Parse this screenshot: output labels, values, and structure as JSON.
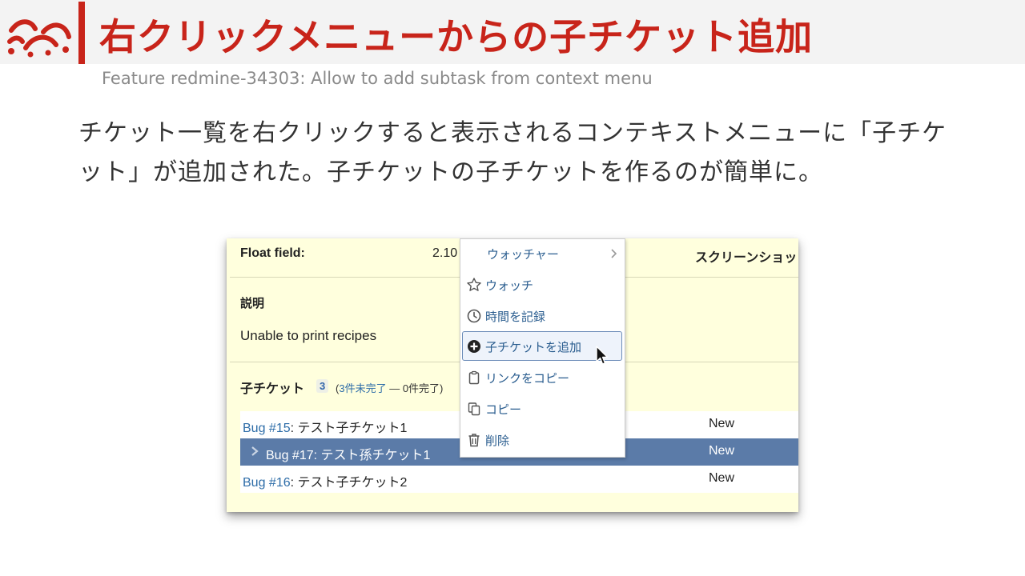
{
  "header": {
    "title": "右クリックメニューからの子チケット追加",
    "subtitle": "Feature redmine-34303: Allow to add subtask from context menu"
  },
  "body": {
    "text": "チケット一覧を右クリックすると表示されるコンテキストメニューに「子チケット」が追加された。子チケットの子チケットを作るのが簡単に。"
  },
  "issue": {
    "float_label": "Float field:",
    "float_value": "2.10",
    "screenshot_label": "スクリーンショッ",
    "description_label": "説明",
    "description_text": "Unable to print recipes",
    "subtasks_label": "子チケット",
    "subtasks_count": "3",
    "subtasks_open": "3件未完了",
    "subtasks_sep": " — ",
    "subtasks_closed": "0件完了)",
    "subtasks_open_prefix": "("
  },
  "subtasks": [
    {
      "id": "Bug #15",
      "subject": ": テスト子チケット1",
      "status": "New"
    },
    {
      "id": "Bug #17",
      "subject": ": テスト孫チケット1",
      "status": "New"
    },
    {
      "id": "Bug #16",
      "subject": ": テスト子チケット2",
      "status": "New"
    }
  ],
  "context_menu": {
    "items": [
      {
        "label": "ウォッチャー",
        "icon": "none",
        "submenu": true
      },
      {
        "label": "ウォッチ",
        "icon": "star-icon"
      },
      {
        "label": "時間を記録",
        "icon": "clock-icon"
      },
      {
        "label": "子チケットを追加",
        "icon": "plus-circle-icon",
        "highlighted": true
      },
      {
        "label": "リンクをコピー",
        "icon": "clipboard-icon"
      },
      {
        "label": "コピー",
        "icon": "copy-icon"
      },
      {
        "label": "削除",
        "icon": "trash-icon"
      }
    ]
  },
  "colors": {
    "accent": "#c8241a",
    "issue_bg": "#ffffdd",
    "selected_row": "#5b7ba8",
    "link": "#2e6da8"
  }
}
